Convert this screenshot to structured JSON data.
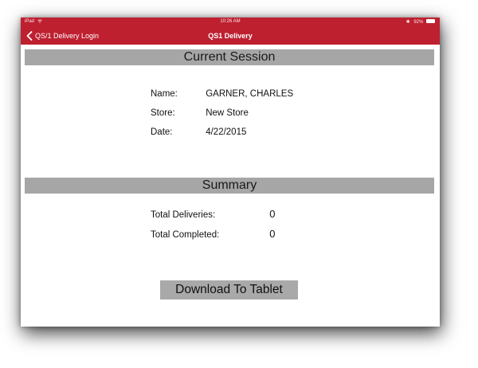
{
  "status_bar": {
    "device": "iPad",
    "time": "10:26 AM",
    "battery": "92%"
  },
  "nav": {
    "back_label": "QS/1 Delivery Login",
    "title": "QS1 Delivery",
    "bar_color": "#be2030"
  },
  "current_session": {
    "header": "Current Session",
    "fields": [
      {
        "label": "Name:",
        "value": "GARNER, CHARLES"
      },
      {
        "label": "Store:",
        "value": "New Store"
      },
      {
        "label": "Date:",
        "value": "4/22/2015"
      }
    ]
  },
  "summary": {
    "header": "Summary",
    "rows": [
      {
        "label": "Total Deliveries:",
        "value": "0"
      },
      {
        "label": "Total Completed:",
        "value": "0"
      }
    ]
  },
  "actions": {
    "download_label": "Download To Tablet"
  },
  "icons": {
    "back": "chevron-left-icon",
    "wifi": "wifi-icon",
    "bluetooth": "bluetooth-icon",
    "battery": "battery-icon"
  }
}
